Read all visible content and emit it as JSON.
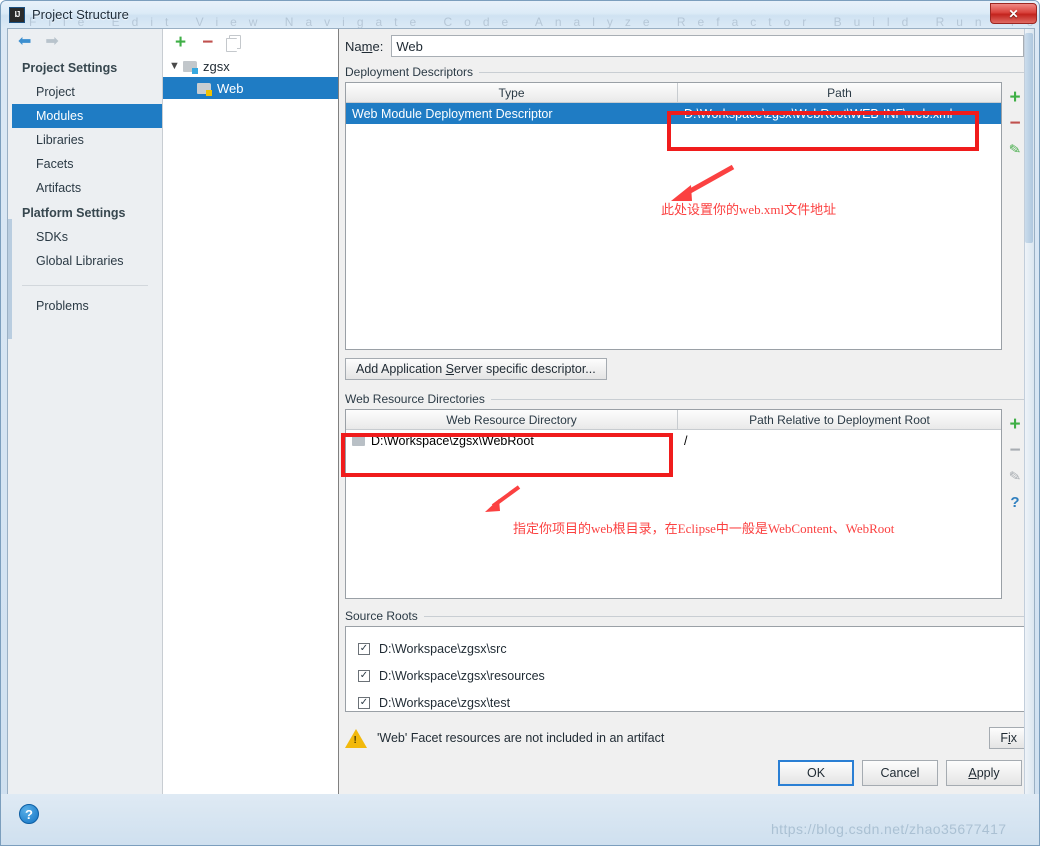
{
  "window": {
    "title": "Project Structure",
    "app_icon": "intellij-icon",
    "close_label": "✕",
    "ghost_menu": "File  Edit  View  Navigate  Code  Analyze  Refactor  Build  Run  Tools  VCS  Window  Help"
  },
  "nav": {
    "back_icon": "arrow-left-icon",
    "forward_icon": "arrow-right-icon",
    "sections": [
      {
        "title": "Project Settings",
        "items": [
          {
            "label": "Project",
            "selected": false
          },
          {
            "label": "Modules",
            "selected": true
          },
          {
            "label": "Libraries",
            "selected": false
          },
          {
            "label": "Facets",
            "selected": false
          },
          {
            "label": "Artifacts",
            "selected": false
          }
        ]
      },
      {
        "title": "Platform Settings",
        "items": [
          {
            "label": "SDKs",
            "selected": false
          },
          {
            "label": "Global Libraries",
            "selected": false
          }
        ]
      }
    ],
    "problems_label": "Problems"
  },
  "tree": {
    "toolbar": {
      "add": "+",
      "remove": "−",
      "copy_icon": "copy-icon"
    },
    "nodes": [
      {
        "label": "zgsx",
        "icon": "module-folder-icon",
        "expanded": true,
        "selected": false,
        "depth": 0
      },
      {
        "label": "Web",
        "icon": "web-facet-icon",
        "expanded": false,
        "selected": true,
        "depth": 1
      }
    ]
  },
  "module": {
    "name_label_pre": "Na",
    "name_label_mnemonic": "m",
    "name_label_post": "e:",
    "name_value": "Web"
  },
  "deployment_descriptors": {
    "group_title": "Deployment Descriptors",
    "columns": [
      "Type",
      "Path"
    ],
    "rows": [
      {
        "type": "Web Module Deployment Descriptor",
        "path": "D:\\Workspace\\zgsx\\WebRoot\\WEB-INF\\web.xml",
        "selected": true
      }
    ],
    "side_buttons": [
      {
        "name": "add-descriptor-button",
        "glyph": "+",
        "enabled": true
      },
      {
        "name": "remove-descriptor-button",
        "glyph": "−",
        "enabled": true
      },
      {
        "name": "edit-descriptor-button",
        "glyph": "✎",
        "enabled": true
      }
    ],
    "add_server_descriptor_button": {
      "pre": "Add Application ",
      "mnemonic": "S",
      "post": "erver specific descriptor..."
    }
  },
  "web_resource_directories": {
    "group_title": "Web Resource Directories",
    "columns": [
      "Web Resource Directory",
      "Path Relative to Deployment Root"
    ],
    "rows": [
      {
        "directory": "D:\\Workspace\\zgsx\\WebRoot",
        "relative_path": "/",
        "icon": "folder-icon"
      }
    ],
    "side_buttons": [
      {
        "name": "add-web-resource-button",
        "glyph": "+",
        "enabled": true
      },
      {
        "name": "remove-web-resource-button",
        "glyph": "−",
        "enabled": false
      },
      {
        "name": "edit-web-resource-button",
        "glyph": "✎",
        "enabled": false
      },
      {
        "name": "help-web-resource-button",
        "glyph": "?",
        "enabled": true
      }
    ]
  },
  "source_roots": {
    "group_title": "Source Roots",
    "items": [
      {
        "label": "D:\\Workspace\\zgsx\\src",
        "checked": true
      },
      {
        "label": "D:\\Workspace\\zgsx\\resources",
        "checked": true
      },
      {
        "label": "D:\\Workspace\\zgsx\\test",
        "checked": true
      }
    ],
    "check_glyph": "✓"
  },
  "warning": {
    "icon": "warning-triangle-icon",
    "text": "'Web' Facet resources are not included in an artifact",
    "fix_button": {
      "pre": "F",
      "mnemonic": "i",
      "post": "x"
    }
  },
  "footer": {
    "buttons": [
      {
        "name": "ok-button",
        "pre": "OK",
        "mnemonic": "",
        "post": "",
        "default": true
      },
      {
        "name": "cancel-button",
        "pre": "Cancel",
        "mnemonic": "",
        "post": "",
        "default": false
      },
      {
        "name": "apply-button",
        "pre": "",
        "mnemonic": "A",
        "post": "pply",
        "default": false
      }
    ],
    "help_button": "?"
  },
  "annotations": [
    {
      "name": "webxml-path-callout",
      "text": "此处设置你的web.xml文件地址"
    },
    {
      "name": "webroot-callout",
      "text": "指定你项目的web根目录，在Eclipse中一般是WebContent、WebRoot"
    }
  ],
  "watermark": "https://blog.csdn.net/zhao35677417",
  "colors": {
    "selection_blue": "#1f7cc4",
    "annotation_red": "#f01c1c",
    "accent_green": "#3faf46",
    "warning_yellow": "#f2b90c"
  }
}
